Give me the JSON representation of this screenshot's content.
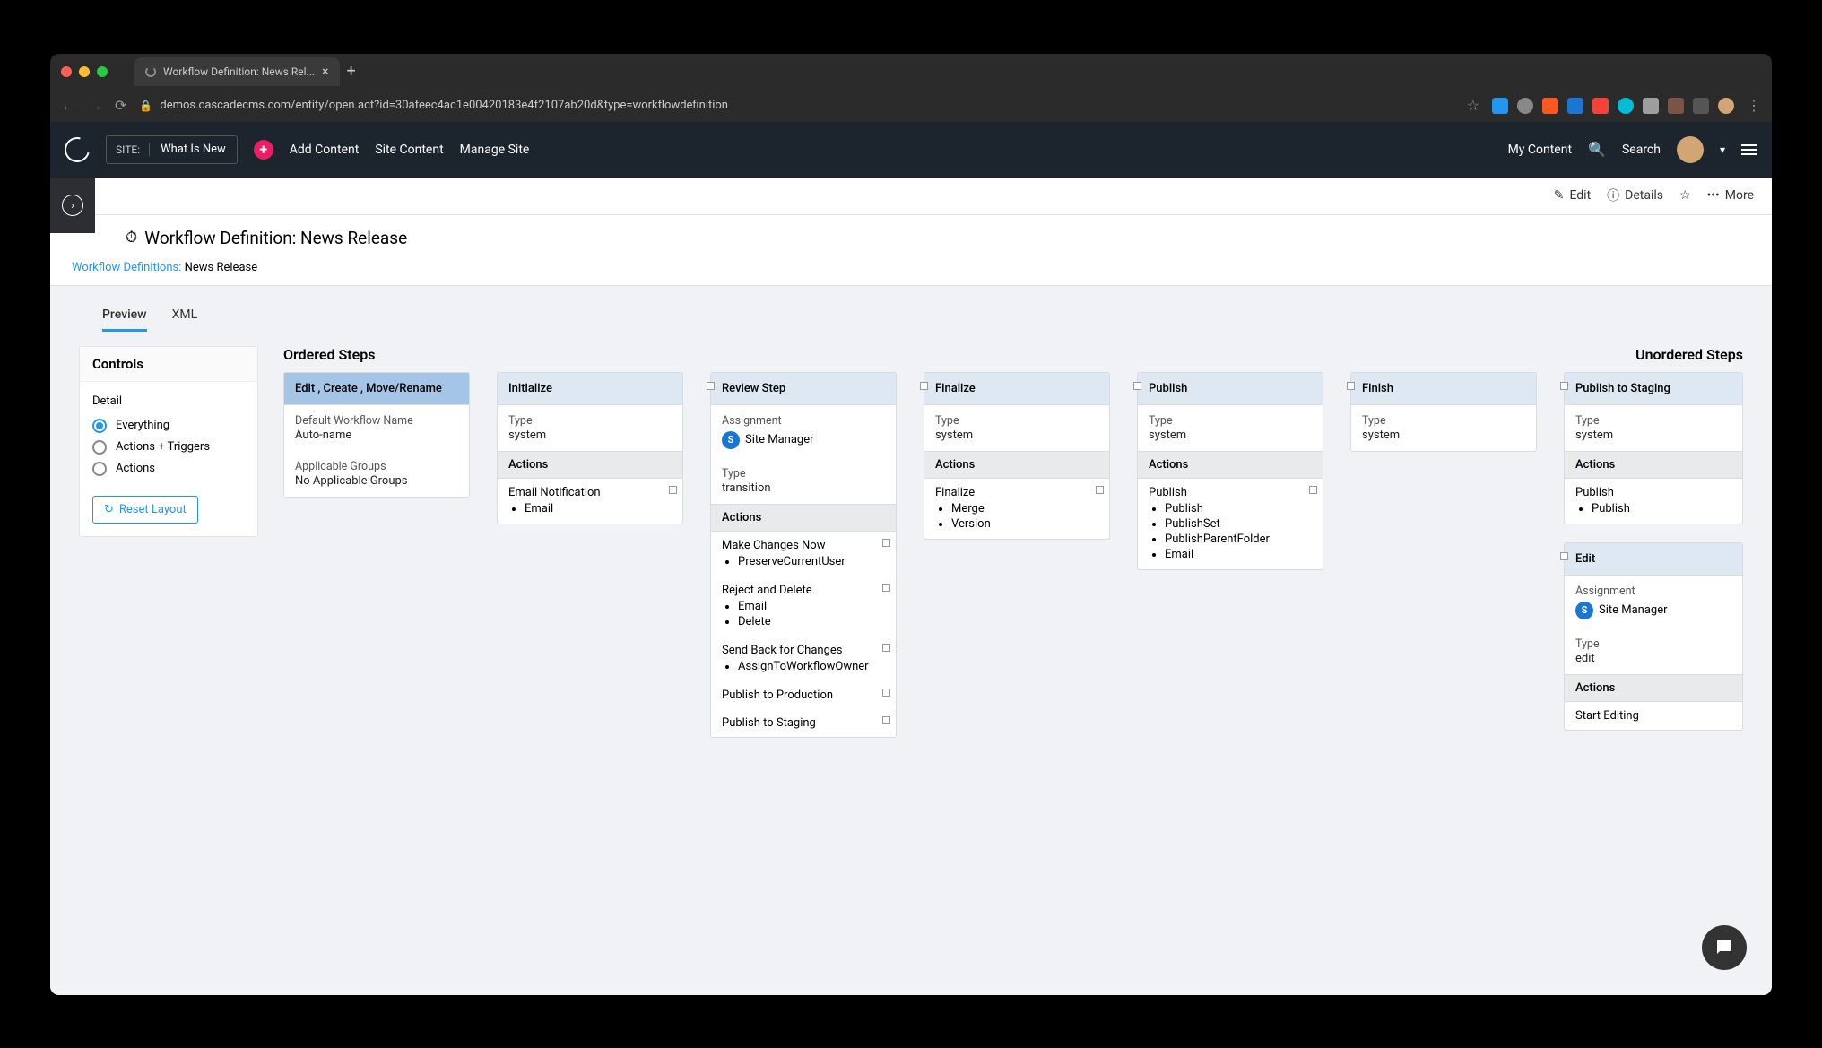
{
  "browser": {
    "tab_title": "Workflow Definition: News Rel...",
    "url": "demos.cascadecms.com/entity/open.act?id=30afeec4ac1e00420183e4f2107ab20d&type=workflowdefinition"
  },
  "header": {
    "site_label": "SITE:",
    "site_value": "What Is New",
    "add_content": "Add Content",
    "site_content": "Site Content",
    "manage_site": "Manage Site",
    "my_content": "My Content",
    "search": "Search"
  },
  "toolbar": {
    "edit": "Edit",
    "details": "Details",
    "more": "More"
  },
  "page_title": "Workflow Definition: News Release",
  "breadcrumb": {
    "link": "Workflow Definitions:",
    "current": "News Release"
  },
  "tabs": {
    "preview": "Preview",
    "xml": "XML"
  },
  "controls": {
    "title": "Controls",
    "detail_label": "Detail",
    "radio_everything": "Everything",
    "radio_actions_triggers": "Actions + Triggers",
    "radio_actions": "Actions",
    "reset": "Reset Layout"
  },
  "ordered_steps_title": "Ordered Steps",
  "unordered_steps_title": "Unordered Steps",
  "step_edit": {
    "title": "Edit , Create , Move/Rename",
    "default_name_lbl": "Default Workflow Name",
    "default_name_val": "Auto-name",
    "groups_lbl": "Applicable Groups",
    "groups_val": "No Applicable Groups"
  },
  "step_init": {
    "title": "Initialize",
    "type_lbl": "Type",
    "type_val": "system",
    "actions_hdr": "Actions",
    "action1": "Email Notification",
    "action1_sub": "Email"
  },
  "step_review": {
    "title": "Review Step",
    "assign_lbl": "Assignment",
    "assign_val": "Site Manager",
    "type_lbl": "Type",
    "type_val": "transition",
    "actions_hdr": "Actions",
    "a1": "Make Changes Now",
    "a1s1": "PreserveCurrentUser",
    "a2": "Reject and Delete",
    "a2s1": "Email",
    "a2s2": "Delete",
    "a3": "Send Back for Changes",
    "a3s1": "AssignToWorkflowOwner",
    "a4": "Publish to Production",
    "a5": "Publish to Staging"
  },
  "step_finalize": {
    "title": "Finalize",
    "type_lbl": "Type",
    "type_val": "system",
    "actions_hdr": "Actions",
    "a1": "Finalize",
    "a1s1": "Merge",
    "a1s2": "Version"
  },
  "step_publish": {
    "title": "Publish",
    "type_lbl": "Type",
    "type_val": "system",
    "actions_hdr": "Actions",
    "a1": "Publish",
    "a1s1": "Publish",
    "a1s2": "PublishSet",
    "a1s3": "PublishParentFolder",
    "a1s4": "Email"
  },
  "step_finish": {
    "title": "Finish",
    "type_lbl": "Type",
    "type_val": "system"
  },
  "step_pts": {
    "title": "Publish to Staging",
    "type_lbl": "Type",
    "type_val": "system",
    "actions_hdr": "Actions",
    "a1": "Publish",
    "a1s1": "Publish"
  },
  "step_uedit": {
    "title": "Edit",
    "assign_lbl": "Assignment",
    "assign_val": "Site Manager",
    "type_lbl": "Type",
    "type_val": "edit",
    "actions_hdr": "Actions",
    "a1": "Start Editing"
  }
}
